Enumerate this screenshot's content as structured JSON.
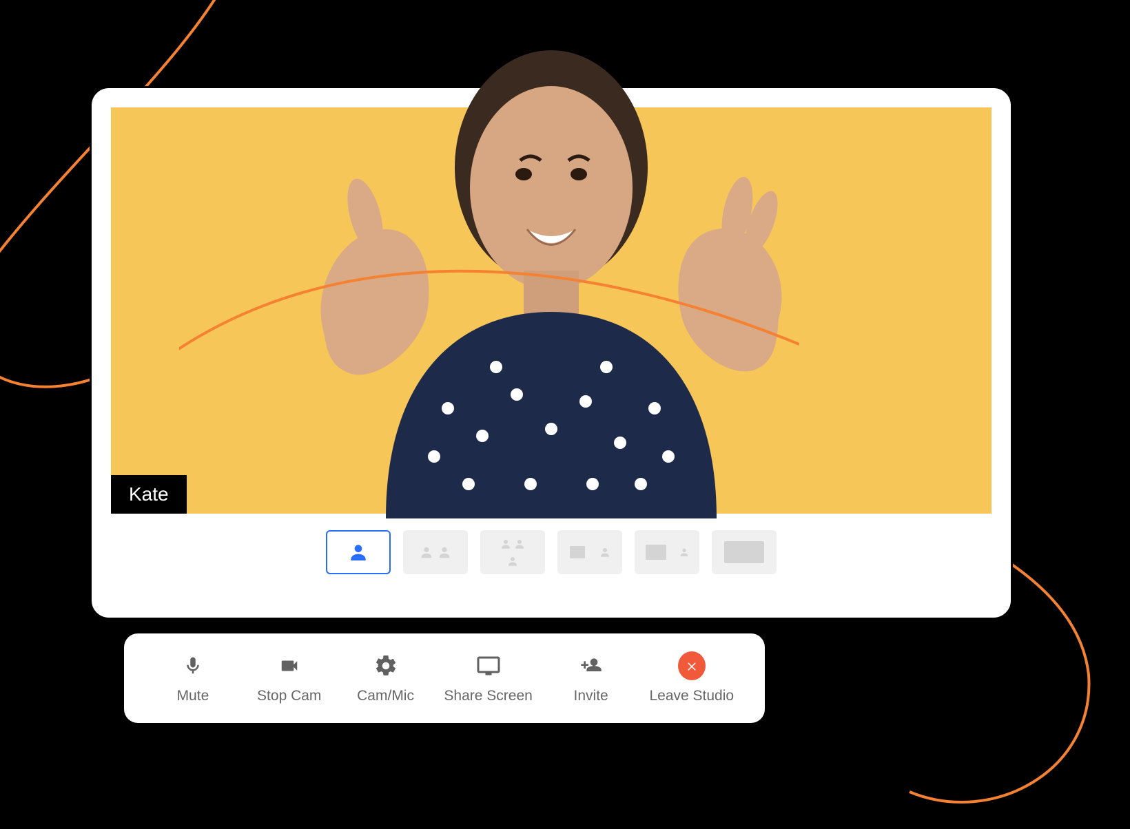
{
  "participant": {
    "name": "Kate"
  },
  "layouts": [
    {
      "id": "solo",
      "active": true
    },
    {
      "id": "two-up",
      "active": false
    },
    {
      "id": "three-up",
      "active": false
    },
    {
      "id": "screen-plus-one",
      "active": false
    },
    {
      "id": "cinema-plus-one",
      "active": false
    },
    {
      "id": "full-screen",
      "active": false
    }
  ],
  "toolbar": {
    "mute_label": "Mute",
    "stop_cam_label": "Stop Cam",
    "cam_mic_label": "Cam/Mic",
    "share_screen_label": "Share Screen",
    "invite_label": "Invite",
    "leave_label": "Leave Studio"
  },
  "colors": {
    "video_bg": "#f7c659",
    "accent": "#286efa",
    "leave": "#f05a3b",
    "swirl": "#f58233"
  }
}
